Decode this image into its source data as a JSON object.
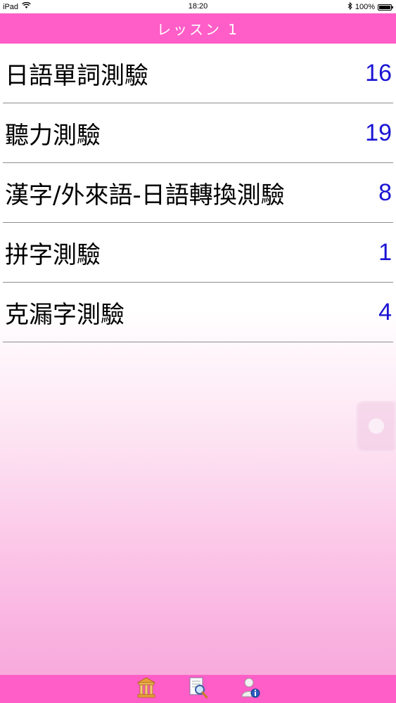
{
  "status_bar": {
    "device": "iPad",
    "time": "18:20",
    "battery": "100%"
  },
  "nav": {
    "title": "レッスン 1"
  },
  "rows": [
    {
      "label": "日語單詞測驗",
      "count": "16"
    },
    {
      "label": "聽力測驗",
      "count": "19"
    },
    {
      "label": "漢字/外來語-日語轉換測驗",
      "count": "8"
    },
    {
      "label": "拼字測驗",
      "count": "1"
    },
    {
      "label": "克漏字測驗",
      "count": "4"
    }
  ],
  "tabs": [
    {
      "icon": "temple-icon"
    },
    {
      "icon": "document-search-icon"
    },
    {
      "icon": "user-info-icon"
    }
  ],
  "colors": {
    "nav": "#ff5ec8",
    "count": "#1a14d4"
  }
}
